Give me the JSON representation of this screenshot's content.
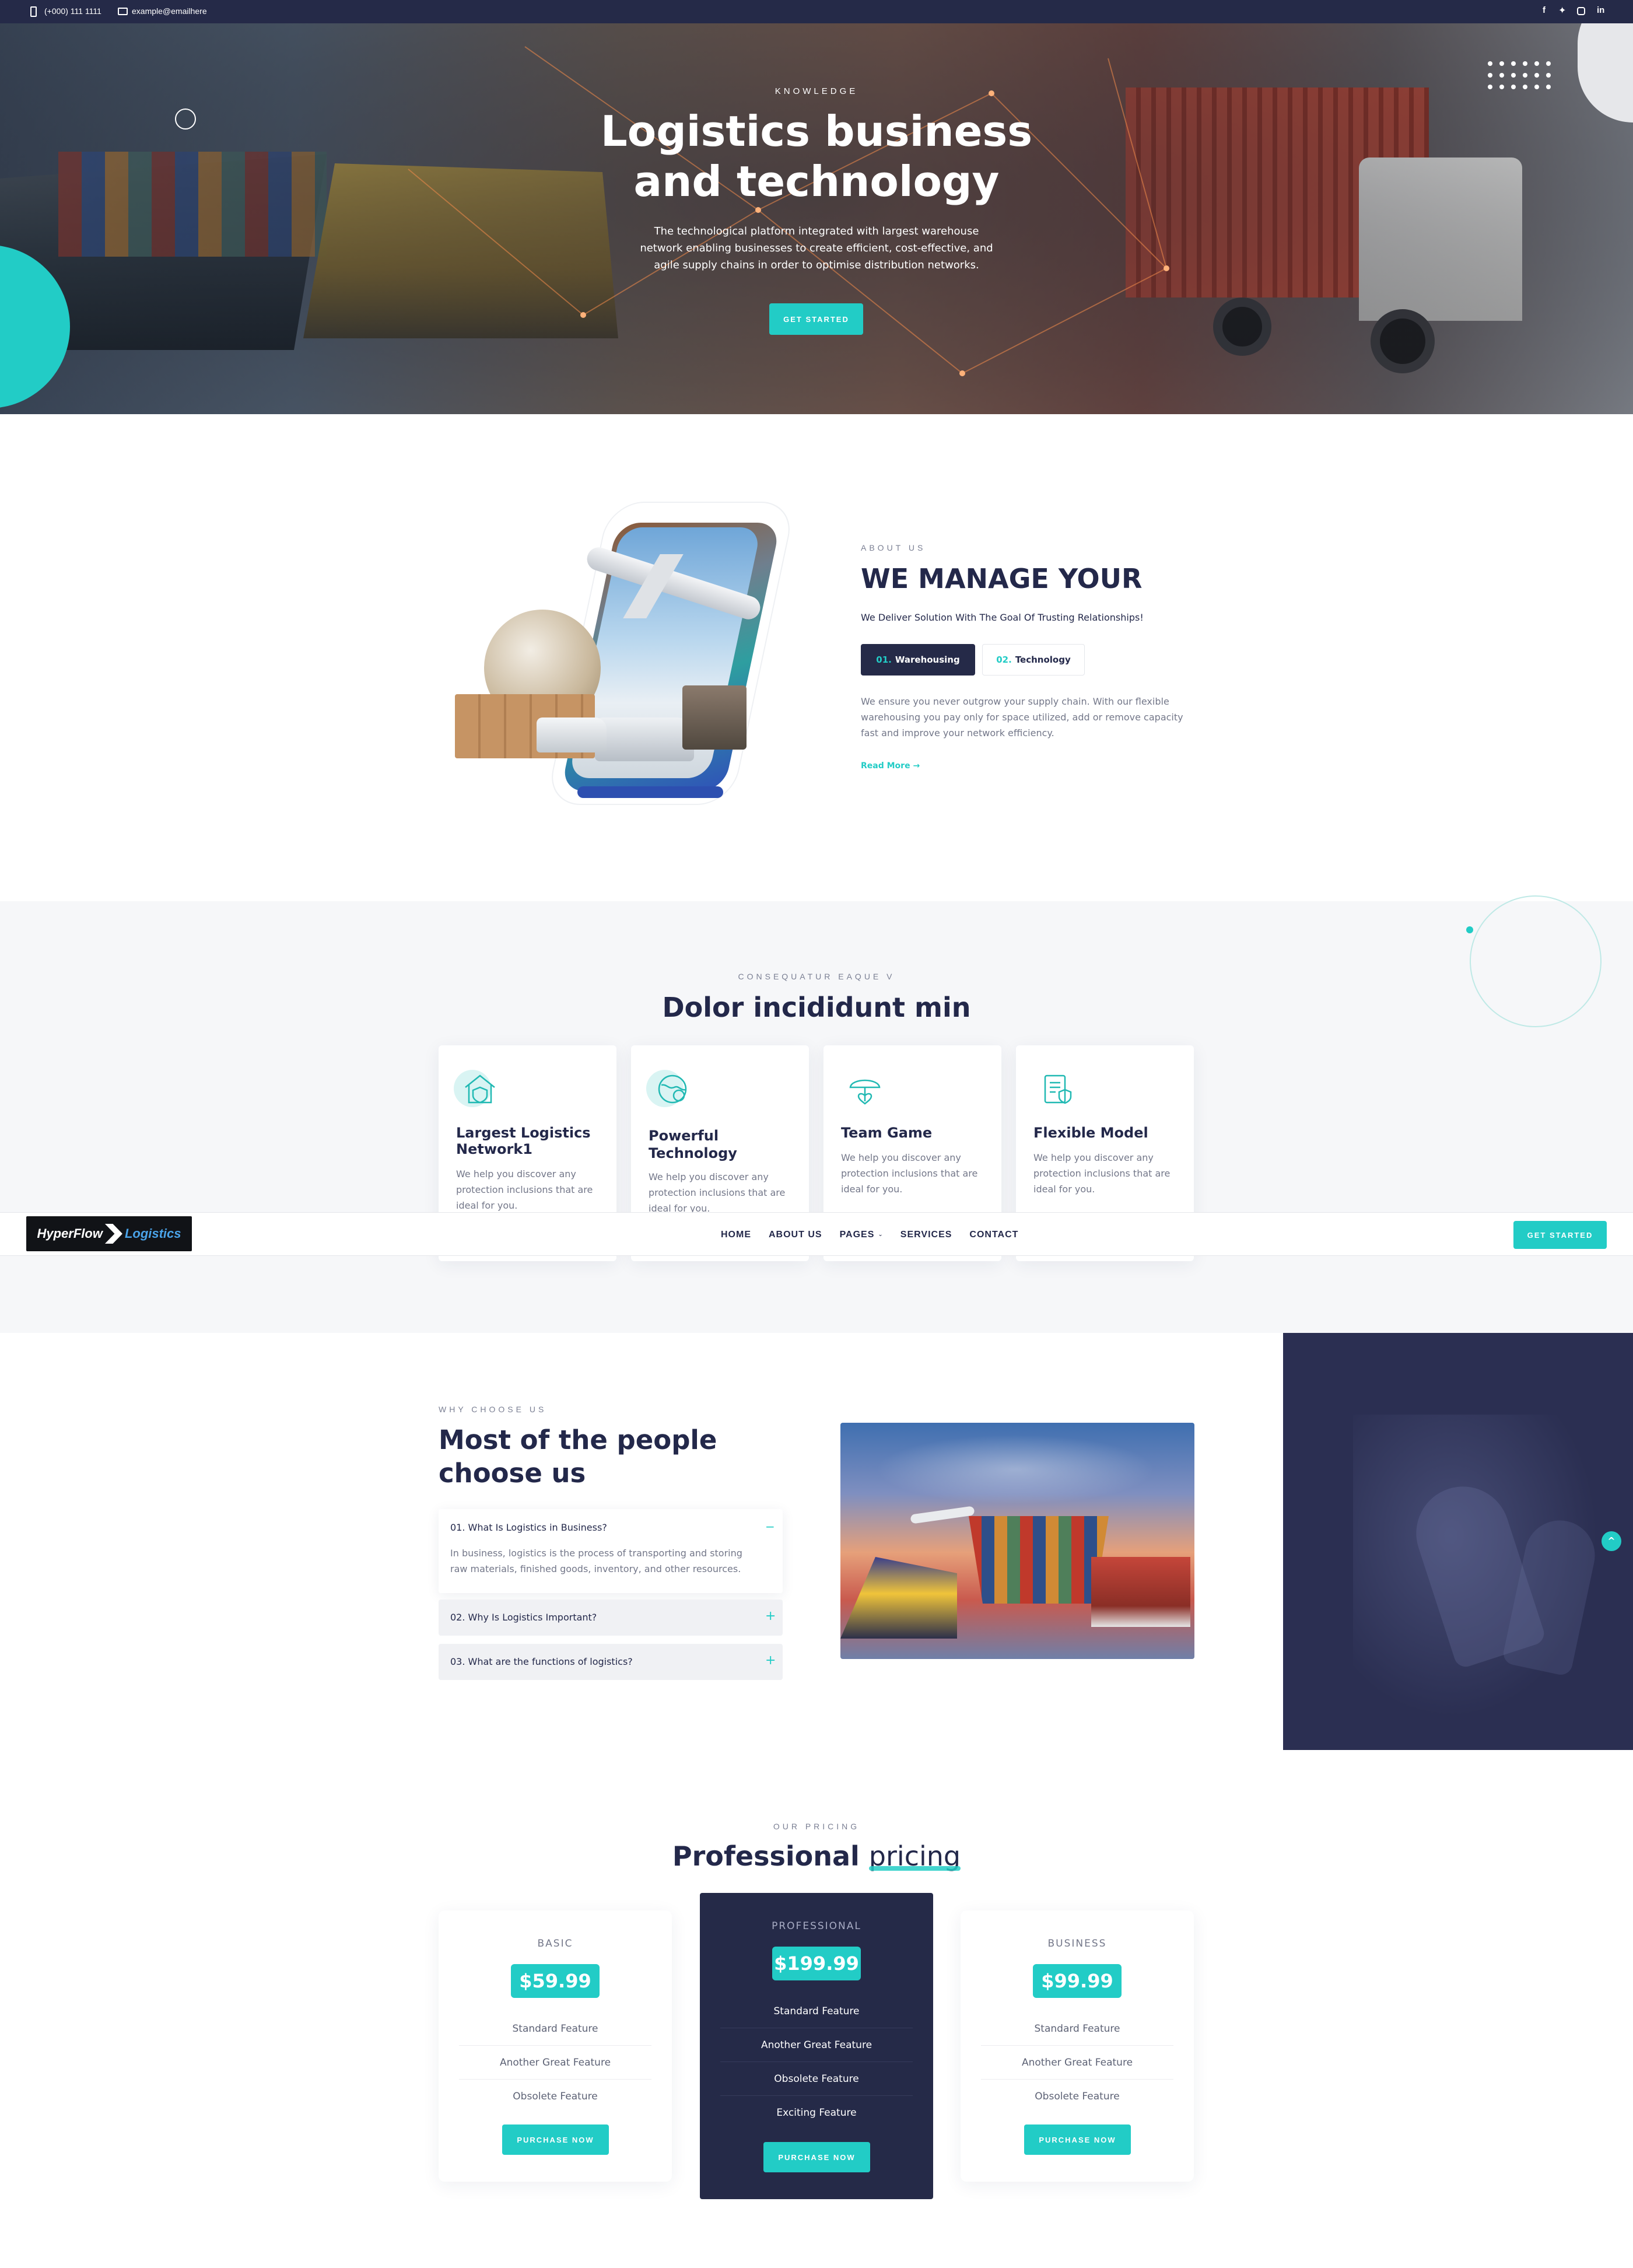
{
  "topbar": {
    "phone": "(+000) 111 1111",
    "email": "example@emailhere",
    "social": [
      "facebook-icon",
      "twitter-icon",
      "instagram-icon",
      "linkedin-icon"
    ]
  },
  "hero": {
    "kicker": "KNOWLEDGE",
    "title_line1": "Logistics business",
    "title_line2": "and technology",
    "subtitle_line1": "The technological platform integrated with largest warehouse",
    "subtitle_line2": "network enabling businesses to create efficient, cost-effective, and",
    "subtitle_line3": "agile supply chains in order to optimise distribution networks.",
    "cta": "GET STARTED"
  },
  "about": {
    "kicker": "ABOUT US",
    "title": "WE MANAGE YOUR",
    "tagline": "We Deliver Solution With The Goal Of Trusting Relationships!",
    "tabs": [
      {
        "num": "01.",
        "label": "Warehousing"
      },
      {
        "num": "02.",
        "label": "Technology"
      }
    ],
    "body_line1": "We ensure you never outgrow your supply chain. With our flexible",
    "body_line2": "warehousing you pay only for space utilized, add or remove capacity",
    "body_line3": "fast and improve your network efficiency.",
    "read_more": "Read More →"
  },
  "features": {
    "kicker": "CONSEQUATUR EAQUE V",
    "title": "Dolor incididunt min",
    "cards": [
      {
        "icon": "house-shield-icon",
        "title_line1": "Largest Logistics",
        "title_line2": "Network1",
        "text_line1": "We help you discover any",
        "text_line2": "protection inclusions that are",
        "text_line3": "ideal for you."
      },
      {
        "icon": "globe-gear-icon",
        "title_line1": "Powerful",
        "title_line2": "Technology",
        "text_line1": "We help you discover any",
        "text_line2": "protection inclusions that are",
        "text_line3": "ideal for you."
      },
      {
        "icon": "umbrella-heart-icon",
        "title_line1": "Team Game",
        "title_line2": "",
        "text_line1": "We help you discover any",
        "text_line2": "protection inclusions that are",
        "text_line3": "ideal for you."
      },
      {
        "icon": "clipboard-shield-icon",
        "title_line1": "Flexible Model",
        "title_line2": "",
        "text_line1": "We help you discover any",
        "text_line2": "protection inclusions that are",
        "text_line3": "ideal for you."
      }
    ]
  },
  "navbar": {
    "logo_part1": "HyperFlow",
    "logo_part2": "Logistics",
    "links": [
      {
        "label": "HOME"
      },
      {
        "label": "ABOUT US"
      },
      {
        "label": "PAGES"
      },
      {
        "label": "SERVICES"
      },
      {
        "label": "CONTACT"
      }
    ],
    "cta": "GET STARTED"
  },
  "why": {
    "kicker": "WHY CHOOSE US",
    "title_line1": "Most of the people",
    "title_line2": "choose us",
    "faq": [
      {
        "q": "01. What Is Logistics in Business?",
        "a_line1": "In business, logistics is the process of transporting and storing",
        "a_line2": "raw materials, finished goods, inventory, and other resources.",
        "toggle": "−"
      },
      {
        "q": "02. Why Is Logistics Important?",
        "toggle": "+"
      },
      {
        "q": "03. What are the functions of logistics?",
        "toggle": "+"
      }
    ]
  },
  "pricing": {
    "kicker": "OUR PRICING",
    "title_part1": "Professional",
    "title_part2": "pricing",
    "plans": [
      {
        "name": "BASIC",
        "price": "$59.99",
        "features": [
          "Standard Feature",
          "Another Great Feature",
          "Obsolete Feature"
        ],
        "cta": "PURCHASE NOW"
      },
      {
        "name": "PROFESSIONAL",
        "price": "$199.99",
        "features": [
          "Standard Feature",
          "Another Great Feature",
          "Obsolete Feature",
          "Exciting Feature"
        ],
        "cta": "PURCHASE NOW"
      },
      {
        "name": "BUSINESS",
        "price": "$99.99",
        "features": [
          "Standard Feature",
          "Another Great Feature",
          "Obsolete Feature"
        ],
        "cta": "PURCHASE NOW"
      }
    ]
  },
  "colors": {
    "navy": "#252a48",
    "teal": "#22ccc6",
    "light_bg": "#f6f7f9"
  }
}
